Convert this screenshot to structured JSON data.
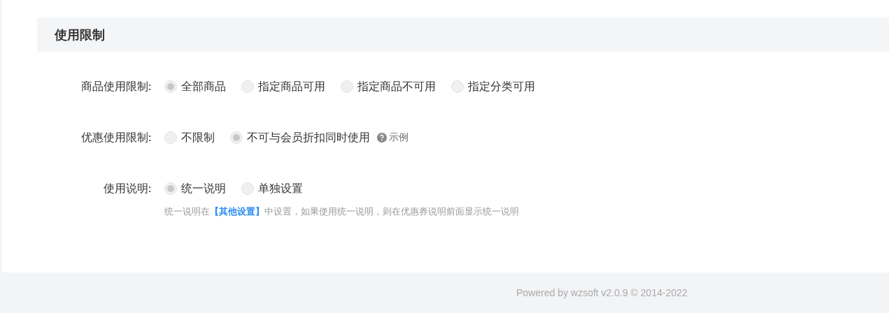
{
  "section": {
    "title": "使用限制"
  },
  "fields": [
    {
      "label": "商品使用限制:",
      "options": [
        {
          "label": "全部商品",
          "selected": true
        },
        {
          "label": "指定商品可用",
          "selected": false
        },
        {
          "label": "指定商品不可用",
          "selected": false
        },
        {
          "label": "指定分类可用",
          "selected": false
        }
      ]
    },
    {
      "label": "优惠使用限制:",
      "options": [
        {
          "label": "不限制",
          "selected": false
        },
        {
          "label": "不可与会员折扣同时使用",
          "selected": true
        }
      ],
      "help": {
        "label": "示例"
      }
    },
    {
      "label": "使用说明:",
      "options": [
        {
          "label": "统一说明",
          "selected": true
        },
        {
          "label": "单独设置",
          "selected": false
        }
      ],
      "hint": {
        "before": "统一说明在",
        "link": "【其他设置】",
        "after": "中设置，如果使用统一说明，则在优惠券说明前面显示统一说明"
      }
    }
  ],
  "footer": "Powered by wzsoft v2.0.9 © 2014-2022"
}
